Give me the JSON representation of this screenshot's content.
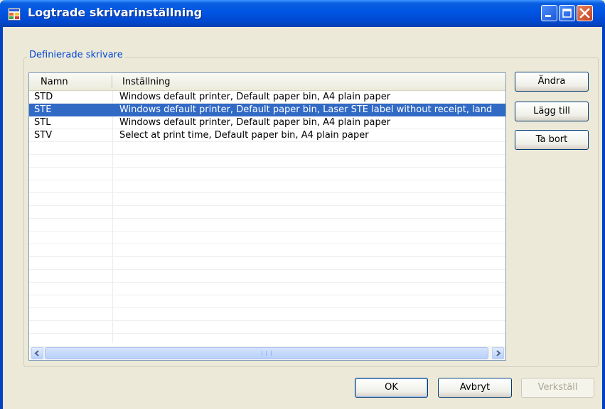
{
  "window": {
    "title": "Logtrade skrivarinställning"
  },
  "group": {
    "legend": "Definierade skrivare"
  },
  "list": {
    "columns": [
      "Namn",
      "Inställning"
    ],
    "rows": [
      {
        "name": "STD",
        "setting": "Windows default printer, Default paper bin, A4 plain paper",
        "selected": false
      },
      {
        "name": "STE",
        "setting": "Windows default printer, Default paper bin, Laser STE label without receipt, land",
        "selected": true
      },
      {
        "name": "STL",
        "setting": "Windows default printer, Default paper bin, A4 plain paper",
        "selected": false
      },
      {
        "name": "STV",
        "setting": "Select at print time, Default paper bin, A4 plain paper",
        "selected": false
      }
    ]
  },
  "side_buttons": {
    "change": "Ändra",
    "add": "Lägg till",
    "remove": "Ta bort"
  },
  "bottom_buttons": {
    "ok": "OK",
    "cancel": "Avbryt",
    "apply": "Verkställ"
  },
  "colors": {
    "title_bar": "#0054e3",
    "selection": "#316ac5",
    "group_legend": "#0046d5",
    "dialog_bg": "#ece9d8"
  },
  "icons": {
    "app": "app-window-icon",
    "minimize": "minimize-icon",
    "maximize": "maximize-icon",
    "close": "close-icon",
    "scroll_left": "arrow-left-icon",
    "scroll_right": "arrow-right-icon"
  }
}
